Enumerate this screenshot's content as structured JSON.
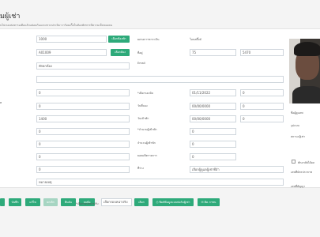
{
  "page": {
    "title": "มผู้เช่า",
    "subtitle": "บไปเรองต่อทารอเยือแล้วมต่อมก้นและตรวจประมิมาวาร้อมเกื้อในห้องพักทารมีความเห็นของคน"
  },
  "left_col": {
    "row1": {
      "value": "1000",
      "button": "เลือกห้องพัก"
    },
    "row2": {
      "value": "A01009",
      "button": "เลือกห้อง"
    },
    "row3": {
      "value": "พักยกห้อง"
    },
    "row4": {
      "value": ""
    },
    "side_label": "ต",
    "numbers": [
      "0",
      "0",
      "1400",
      "0",
      "0",
      "0",
      "0"
    ],
    "note": "หมายเหตุ"
  },
  "mid_col": {
    "labels": [
      "ผลรอการชาระเงิน",
      "ที่อยู่",
      "Email",
      "*เลือกรอบบิล",
      "วันที่จอง",
      "วันเข้าพัก",
      "*จำนวนผู้เข้าพัก",
      "จำนวนผู้เข้าพัก",
      "ยอดผลิตรายการ",
      "ที่ร่าง"
    ],
    "values": {
      "payment_status": "โอนสดี๊งค์",
      "address_1": "75",
      "address_2": "5470",
      "bill_round": "01/11/2022",
      "booking_date": "00/00/0000",
      "move_in": "00/00/0000",
      "guests": "0",
      "guests2": "0",
      "summary": "0",
      "draft": "เลือกผู้ดูแลผู้เช่าที่อำ"
    },
    "side_values": [
      "0",
      "0",
      "0"
    ]
  },
  "right_col": {
    "labels": [
      "ชื่อผู้ดูแลพ",
      "รูปแบบ",
      "สถานะผู้เช่า",
      "เลขที่บัตรประชาช",
      "เลขที่สัญญา",
      "เลขที่ใบรับรอง"
    ],
    "checkbox_label": "พักอาศัยได้ผล"
  },
  "footer": {
    "buttons": [
      "บันทึก",
      "แก้ไข",
      "ยกเลิก",
      "ยืนยัน",
      "ลบข้อ"
    ],
    "status_label": "*เลือกรอบหน่าปรับ",
    "select": "เลือกรอบหน่าปรับ",
    "pick": "เลือก",
    "print_btn": "พิมพ์ข้อมูลแบบฟอร์มผู้เช่า",
    "chat_btn": "ติด ภาชน"
  },
  "colors": {
    "green": "#2eaa7a",
    "grey_btn": "#a6d5c2"
  }
}
